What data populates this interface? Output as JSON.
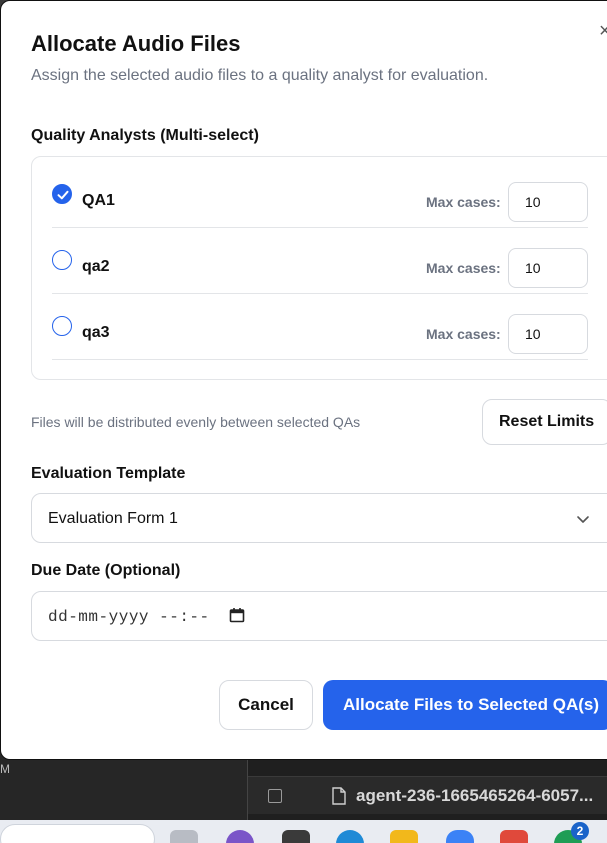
{
  "dialog": {
    "title": "Allocate Audio Files",
    "subtitle": "Assign the selected audio files to a quality analyst for evaluation.",
    "close_label": "×"
  },
  "analysts": {
    "label": "Quality Analysts (Multi-select)",
    "max_label": "Max cases:",
    "items": [
      {
        "name": "QA1",
        "selected": true,
        "max_cases": "10"
      },
      {
        "name": "qa2",
        "selected": false,
        "max_cases": "10"
      },
      {
        "name": "qa3",
        "selected": false,
        "max_cases": "10"
      }
    ]
  },
  "distribution_note": "Files will be distributed evenly between selected QAs",
  "reset_label": "Reset Limits",
  "template": {
    "label": "Evaluation Template",
    "selected": "Evaluation Form 1"
  },
  "due_date": {
    "label": "Due Date (Optional)",
    "placeholder": "dd-mm-yyyy --:--"
  },
  "actions": {
    "cancel_label": "Cancel",
    "submit_label": "Allocate Files to Selected QA(s)"
  },
  "background": {
    "left_text": "M",
    "file_name": "agent-236-1665465264-6057..."
  },
  "taskbar": {
    "badge_count": "2"
  },
  "colors": {
    "accent": "#2563eb",
    "muted_text": "#6b7280",
    "border": "#d7dadf"
  }
}
